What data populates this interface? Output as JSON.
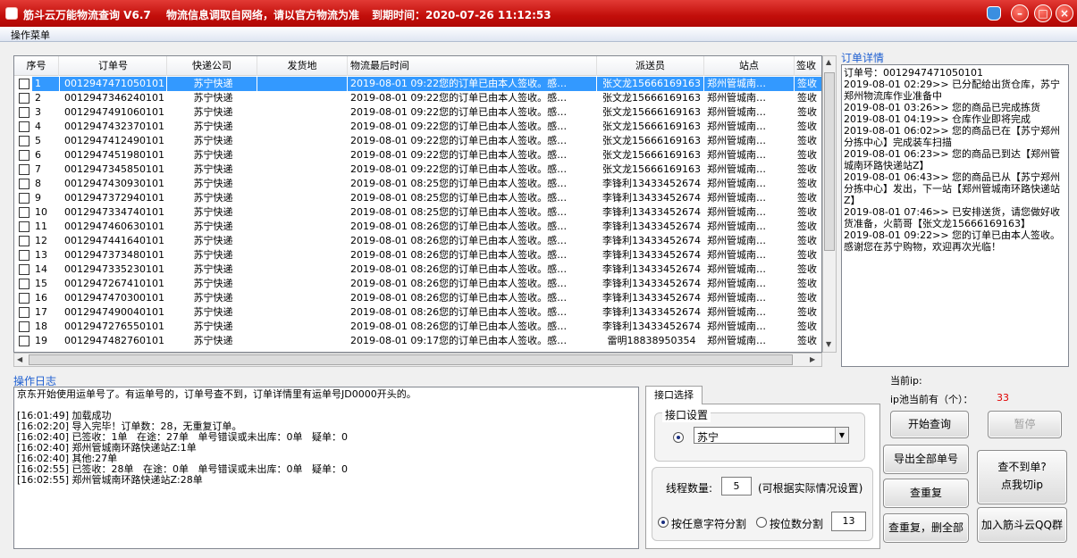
{
  "titlebar": {
    "app_title": "筋斗云万能物流查询 V6.7",
    "notice": "物流信息调取自网络，请以官方物流为准",
    "expiry": "到期时间：2020-07-26 11:12:53"
  },
  "menu": {
    "operations": "操作菜单"
  },
  "grid": {
    "columns": [
      "序号",
      "订单号",
      "快递公司",
      "发货地",
      "物流最后时间",
      "派送员",
      "站点",
      "签收"
    ],
    "rows": [
      {
        "no": "1",
        "order": "0012947471050101",
        "company": "苏宁快递",
        "origin": "",
        "last": "2019-08-01 09:22您的订单已由本人签收。感…",
        "courier": "张文龙15666169163",
        "station": "郑州管城南…",
        "sign": "签收"
      },
      {
        "no": "2",
        "order": "0012947346240101",
        "company": "苏宁快递",
        "origin": "",
        "last": "2019-08-01 09:22您的订单已由本人签收。感…",
        "courier": "张文龙15666169163",
        "station": "郑州管城南…",
        "sign": "签收"
      },
      {
        "no": "3",
        "order": "0012947491060101",
        "company": "苏宁快递",
        "origin": "",
        "last": "2019-08-01 09:22您的订单已由本人签收。感…",
        "courier": "张文龙15666169163",
        "station": "郑州管城南…",
        "sign": "签收"
      },
      {
        "no": "4",
        "order": "0012947432370101",
        "company": "苏宁快递",
        "origin": "",
        "last": "2019-08-01 09:22您的订单已由本人签收。感…",
        "courier": "张文龙15666169163",
        "station": "郑州管城南…",
        "sign": "签收"
      },
      {
        "no": "5",
        "order": "0012947412490101",
        "company": "苏宁快递",
        "origin": "",
        "last": "2019-08-01 09:22您的订单已由本人签收。感…",
        "courier": "张文龙15666169163",
        "station": "郑州管城南…",
        "sign": "签收"
      },
      {
        "no": "6",
        "order": "0012947451980101",
        "company": "苏宁快递",
        "origin": "",
        "last": "2019-08-01 09:22您的订单已由本人签收。感…",
        "courier": "张文龙15666169163",
        "station": "郑州管城南…",
        "sign": "签收"
      },
      {
        "no": "7",
        "order": "0012947345850101",
        "company": "苏宁快递",
        "origin": "",
        "last": "2019-08-01 09:22您的订单已由本人签收。感…",
        "courier": "张文龙15666169163",
        "station": "郑州管城南…",
        "sign": "签收"
      },
      {
        "no": "8",
        "order": "0012947430930101",
        "company": "苏宁快递",
        "origin": "",
        "last": "2019-08-01 08:25您的订单已由本人签收。感…",
        "courier": "李锋利13433452674",
        "station": "郑州管城南…",
        "sign": "签收"
      },
      {
        "no": "9",
        "order": "0012947372940101",
        "company": "苏宁快递",
        "origin": "",
        "last": "2019-08-01 08:25您的订单已由本人签收。感…",
        "courier": "李锋利13433452674",
        "station": "郑州管城南…",
        "sign": "签收"
      },
      {
        "no": "10",
        "order": "0012947334740101",
        "company": "苏宁快递",
        "origin": "",
        "last": "2019-08-01 08:25您的订单已由本人签收。感…",
        "courier": "李锋利13433452674",
        "station": "郑州管城南…",
        "sign": "签收"
      },
      {
        "no": "11",
        "order": "0012947460630101",
        "company": "苏宁快递",
        "origin": "",
        "last": "2019-08-01 08:26您的订单已由本人签收。感…",
        "courier": "李锋利13433452674",
        "station": "郑州管城南…",
        "sign": "签收"
      },
      {
        "no": "12",
        "order": "0012947441640101",
        "company": "苏宁快递",
        "origin": "",
        "last": "2019-08-01 08:26您的订单已由本人签收。感…",
        "courier": "李锋利13433452674",
        "station": "郑州管城南…",
        "sign": "签收"
      },
      {
        "no": "13",
        "order": "0012947373480101",
        "company": "苏宁快递",
        "origin": "",
        "last": "2019-08-01 08:26您的订单已由本人签收。感…",
        "courier": "李锋利13433452674",
        "station": "郑州管城南…",
        "sign": "签收"
      },
      {
        "no": "14",
        "order": "0012947335230101",
        "company": "苏宁快递",
        "origin": "",
        "last": "2019-08-01 08:26您的订单已由本人签收。感…",
        "courier": "李锋利13433452674",
        "station": "郑州管城南…",
        "sign": "签收"
      },
      {
        "no": "15",
        "order": "0012947267410101",
        "company": "苏宁快递",
        "origin": "",
        "last": "2019-08-01 08:26您的订单已由本人签收。感…",
        "courier": "李锋利13433452674",
        "station": "郑州管城南…",
        "sign": "签收"
      },
      {
        "no": "16",
        "order": "0012947470300101",
        "company": "苏宁快递",
        "origin": "",
        "last": "2019-08-01 08:26您的订单已由本人签收。感…",
        "courier": "李锋利13433452674",
        "station": "郑州管城南…",
        "sign": "签收"
      },
      {
        "no": "17",
        "order": "0012947490040101",
        "company": "苏宁快递",
        "origin": "",
        "last": "2019-08-01 08:26您的订单已由本人签收。感…",
        "courier": "李锋利13433452674",
        "station": "郑州管城南…",
        "sign": "签收"
      },
      {
        "no": "18",
        "order": "0012947276550101",
        "company": "苏宁快递",
        "origin": "",
        "last": "2019-08-01 08:26您的订单已由本人签收。感…",
        "courier": "李锋利13433452674",
        "station": "郑州管城南…",
        "sign": "签收"
      },
      {
        "no": "19",
        "order": "0012947482760101",
        "company": "苏宁快递",
        "origin": "",
        "last": "2019-08-01 09:17您的订单已由本人签收。感…",
        "courier": "雷明18838950354",
        "station": "郑州管城南…",
        "sign": "签收"
      }
    ]
  },
  "detail": {
    "title": "订单详情",
    "text": "订单号：0012947471050101\n2019-08-01 02:29>> 已分配给出货仓库，苏宁郑州物流库作业准备中\n2019-08-01 03:26>> 您的商品已完成拣货\n2019-08-01 04:19>> 仓库作业即将完成\n2019-08-01 06:02>> 您的商品已在【苏宁郑州分拣中心】完成装车扫描\n2019-08-01 06:23>> 您的商品已到达【郑州管城南环路快递站Z】\n2019-08-01 06:43>> 您的商品已从【苏宁郑州分拣中心】发出，下一站【郑州管城南环路快递站Z】\n2019-08-01 07:46>> 已安排送货，请您做好收货准备，火箭哥【张文龙15666169163】\n2019-08-01 09:22>> 您的订单已由本人签收。感谢您在苏宁购物，欢迎再次光临！"
  },
  "log": {
    "title": "操作日志",
    "text": "京东开始使用运单号了。有运单号的，订单号查不到，订单详情里有运单号JD0000开头的。\n\n[16:01:49] 加载成功\n[16:02:20] 导入完毕！订单数：28，无重复订单。\n[16:02:40] 已签收：1单   在途：27单   单号错误或未出库：0单   疑单：0\n[16:02:40] 郑州管城南环路快递站Z:1单\n[16:02:40] 其他:27单\n[16:02:55] 已签收：28单   在途：0单   单号错误或未出库：0单   疑单：0\n[16:02:55] 郑州管城南环路快递站Z:28单"
  },
  "interface": {
    "tab_label": "接口选择",
    "group_label": "接口设置",
    "selected_api": "苏宁",
    "threads_label": "线程数量:",
    "threads_value": "5",
    "threads_hint": "(可根据实际情况设置)",
    "split_any_label": "按任意字符分割",
    "split_digits_label": "按位数分割",
    "digits_value": "13"
  },
  "side": {
    "current_ip_label": "当前ip:",
    "pool_label": "ip池当前有（个）：",
    "pool_count": "33",
    "start_button": "开始查询",
    "pause_button": "暂停",
    "export_button": "导出全部单号",
    "not_found_line1": "查不到单?",
    "not_found_line2": "点我切ip",
    "check_dup_button": "查重复",
    "check_dup_delete_button": "查重复，删全部",
    "join_qq_button": "加入筋斗云QQ群"
  },
  "colors": {
    "titlebar": "#c20e0a",
    "selection": "#3399ff",
    "section_label": "#1e5fd1",
    "pool_count": "#e00000"
  }
}
